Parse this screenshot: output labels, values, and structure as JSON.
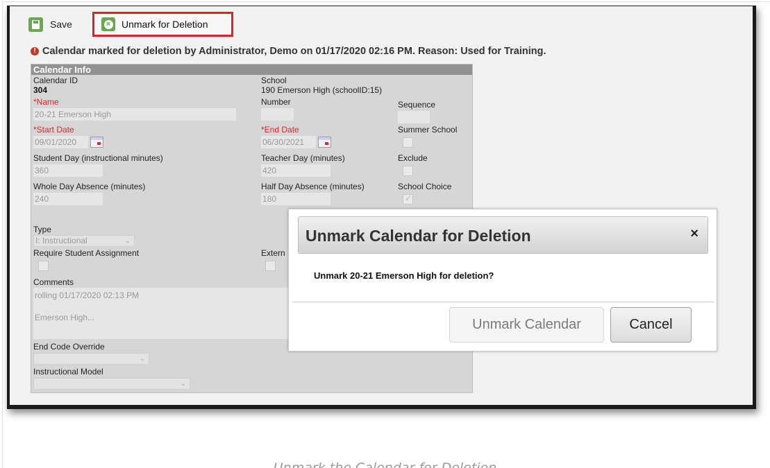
{
  "toolbar": {
    "save_label": "Save",
    "unmark_label": "Unmark for Deletion"
  },
  "warning": {
    "text": "Calendar marked for deletion by Administrator, Demo on 01/17/2020 02:16 PM. Reason: Used for Training."
  },
  "panel": {
    "header": "Calendar Info",
    "calendar_id_label": "Calendar ID",
    "calendar_id_value": "304",
    "school_label": "School",
    "school_value": "190 Emerson High (schoolID:15)",
    "name_label": "*Name",
    "name_value": "20-21 Emerson High",
    "number_label": "Number",
    "sequence_label": "Sequence",
    "start_date_label": "*Start Date",
    "start_date_value": "09/01/2020",
    "end_date_label": "*End Date",
    "end_date_value": "06/30/2021",
    "summer_school_label": "Summer School",
    "student_day_label": "Student Day (instructional minutes)",
    "student_day_value": "360",
    "teacher_day_label": "Teacher Day (minutes)",
    "teacher_day_value": "420",
    "exclude_label": "Exclude",
    "whole_day_label": "Whole Day Absence (minutes)",
    "whole_day_value": "240",
    "half_day_label": "Half Day Absence (minutes)",
    "half_day_value": "180",
    "school_choice_label": "School Choice",
    "type_label": "Type",
    "type_value": "I: Instructional",
    "require_student_label": "Require Student Assignment",
    "extern_label": "Extern",
    "comments_label": "Comments",
    "comments_line1": "rolling 01/17/2020 02:13 PM",
    "comments_line2": "Emerson High...",
    "end_code_label": "End Code Override",
    "instructional_model_label": "Instructional Model"
  },
  "dialog": {
    "title": "Unmark Calendar for Deletion",
    "close_symbol": "×",
    "message": "Unmark 20-21 Emerson High for deletion?",
    "confirm_label": "Unmark Calendar",
    "cancel_label": "Cancel"
  },
  "caption": "Unmark the Calendar for Deletion",
  "colors": {
    "accent_green": "#6aa84f",
    "highlight_red": "#e32020",
    "required_red": "#d62a2a",
    "panel_header": "#929292"
  }
}
